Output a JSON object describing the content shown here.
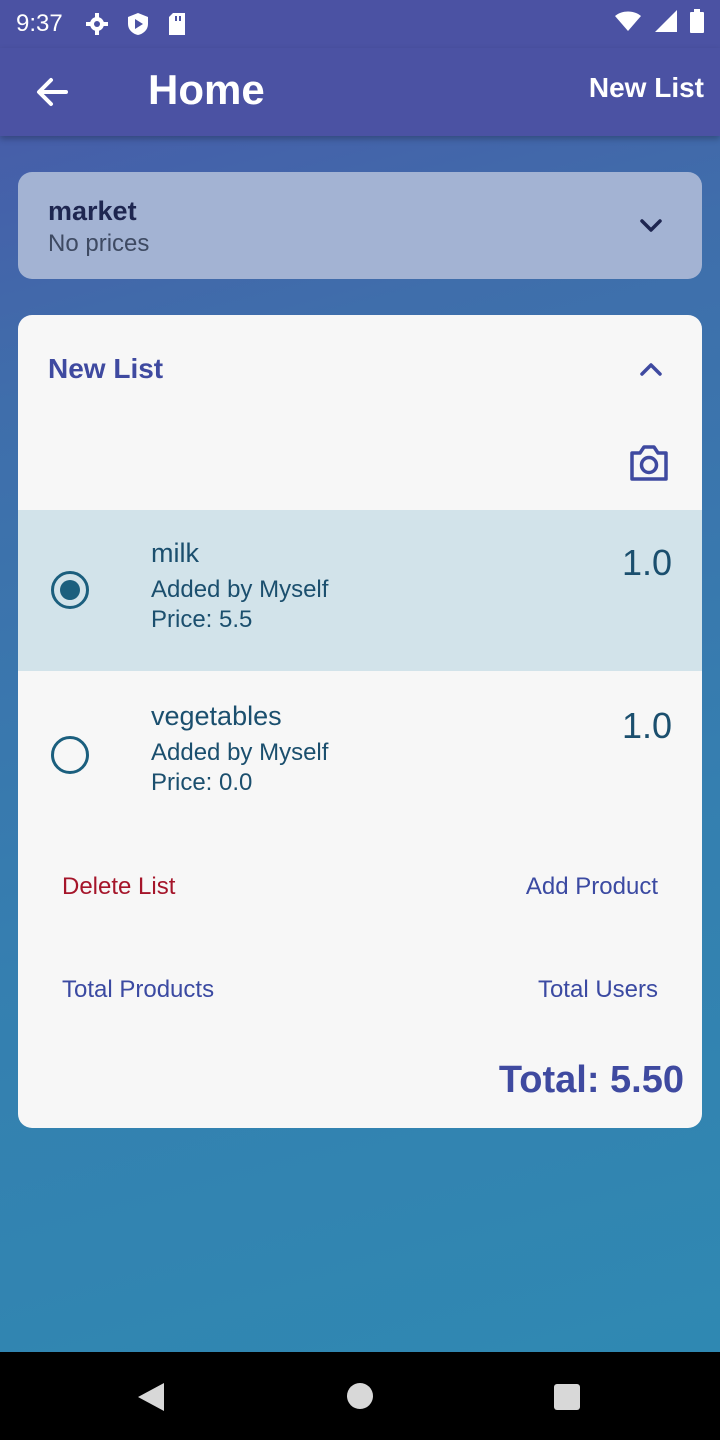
{
  "status_bar": {
    "time": "9:37",
    "icons": [
      "gear-icon",
      "shield-play-icon",
      "sd-card-icon",
      "wifi-icon",
      "signal-icon",
      "battery-icon"
    ]
  },
  "app_bar": {
    "title": "Home",
    "action_label": "New List",
    "back_icon": "arrow-left-icon"
  },
  "lists": [
    {
      "name": "market",
      "subtitle": "No prices",
      "expanded": false
    }
  ],
  "open_list": {
    "title": "New List",
    "items": [
      {
        "name": "milk",
        "added_by": "Added by Myself",
        "price": "Price: 5.5",
        "quantity": "1.0",
        "selected": true
      },
      {
        "name": "vegetables",
        "added_by": "Added by Myself",
        "price": "Price: 0.0",
        "quantity": "1.0",
        "selected": false
      }
    ],
    "delete_label": "Delete List",
    "add_label": "Add Product",
    "total_products_label": "Total Products",
    "total_users_label": "Total Users",
    "total": "Total: 5.50"
  },
  "colors": {
    "app_bar": "#4b52a3",
    "accent": "#3f4aa0",
    "danger": "#a5152a",
    "selected_row": "#d2e3ea",
    "item_text": "#1b4f6e"
  }
}
